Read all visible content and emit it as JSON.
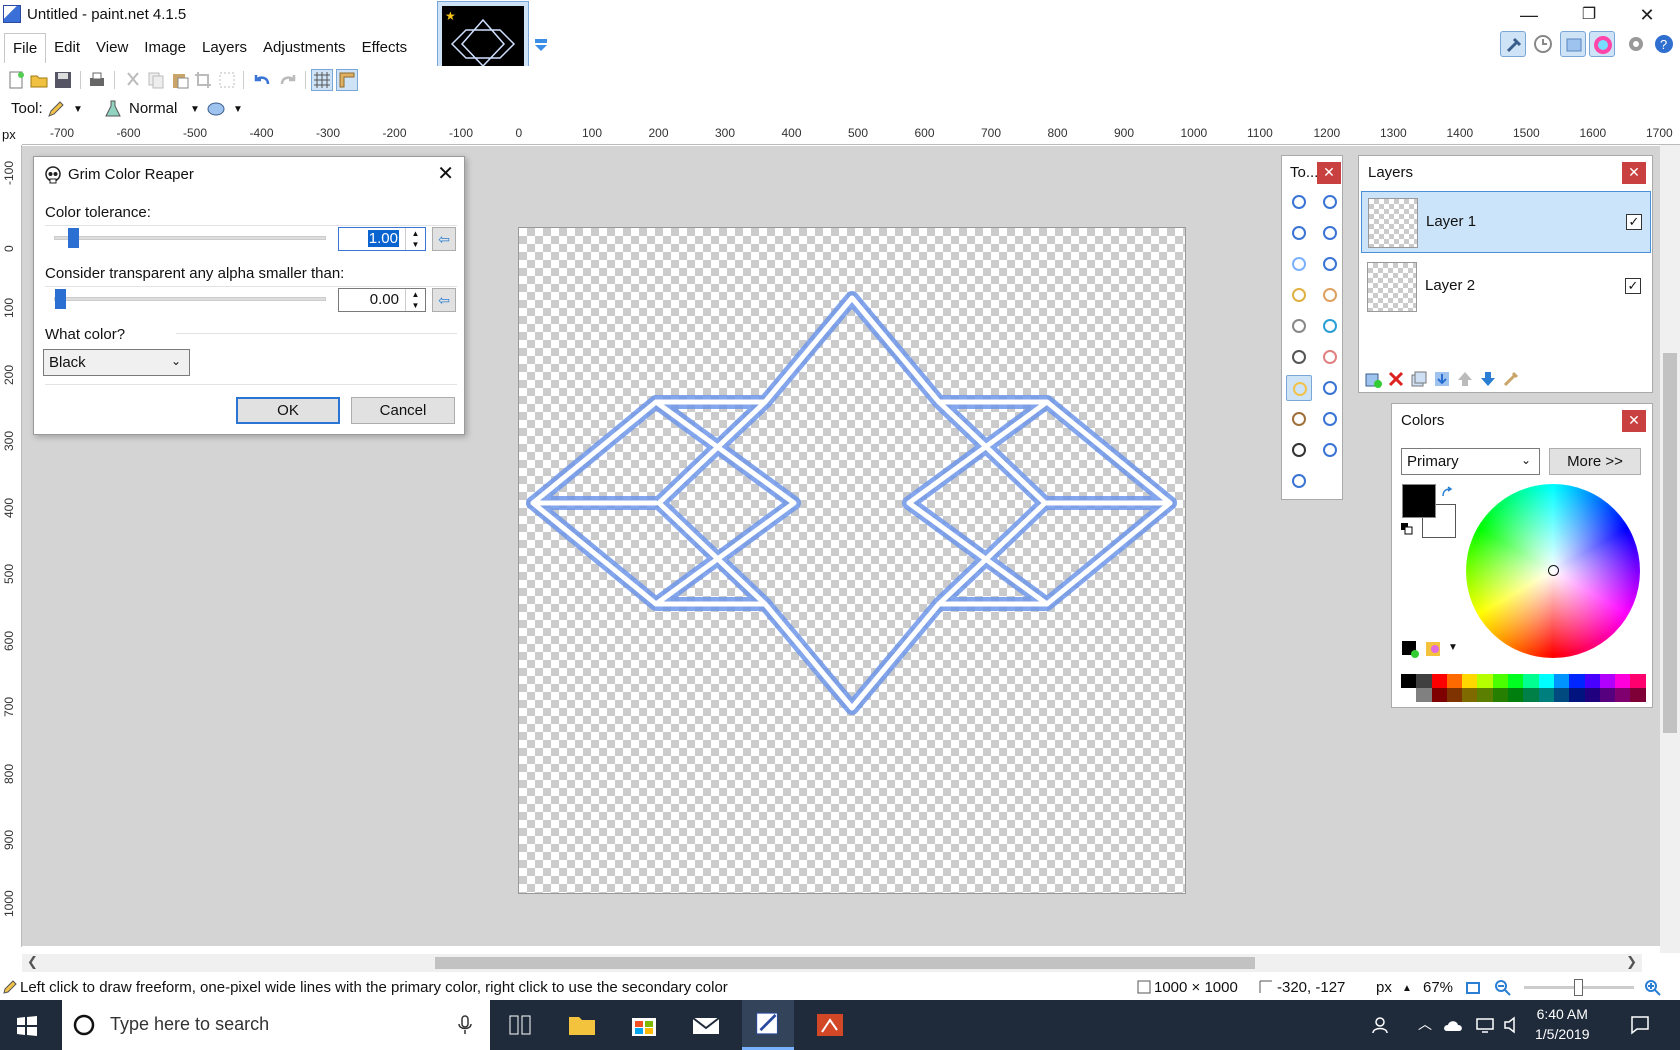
{
  "window": {
    "title": "Untitled - paint.net 4.1.5",
    "minimize": "—",
    "maximize": "❐",
    "close": "✕"
  },
  "menu": [
    "File",
    "Edit",
    "View",
    "Image",
    "Layers",
    "Adjustments",
    "Effects"
  ],
  "toolbar2": {
    "tool_label": "Tool:",
    "blend_mode": "Normal"
  },
  "ruler": {
    "unit": "px",
    "h_labels": [
      "-700",
      "-600",
      "-500",
      "-400",
      "-300",
      "-200",
      "-100",
      "0",
      "100",
      "200",
      "300",
      "400",
      "500",
      "600",
      "700",
      "800",
      "900",
      "1000",
      "1100",
      "1200",
      "1300",
      "1400",
      "1500",
      "1600",
      "1700"
    ],
    "v_labels": [
      "-100",
      "0",
      "100",
      "200",
      "300",
      "400",
      "500",
      "600",
      "700",
      "800",
      "900",
      "1000"
    ]
  },
  "dialog": {
    "title": "Grim Color Reaper",
    "close": "✕",
    "tolerance_label": "Color tolerance:",
    "tolerance_value": "1.00",
    "tolerance_slider": 0.05,
    "alpha_label": "Consider transparent any alpha smaller than:",
    "alpha_value": "0.00",
    "alpha_slider": 0.0,
    "color_label": "What color?",
    "color_value": "Black",
    "ok": "OK",
    "cancel": "Cancel"
  },
  "tools_panel": {
    "title": "To...",
    "close": "✕"
  },
  "layers_panel": {
    "title": "Layers",
    "close": "✕",
    "layers": [
      {
        "name": "Layer 1",
        "visible": "✓"
      },
      {
        "name": "Layer 2",
        "visible": "✓"
      }
    ]
  },
  "colors_panel": {
    "title": "Colors",
    "close": "✕",
    "mode": "Primary",
    "more_button": "More >>",
    "primary_color": "#000000",
    "secondary_color": "#ffffff"
  },
  "status": {
    "hint": "Left click to draw freeform, one-pixel wide lines with the primary color, right click to use the secondary color",
    "image_size": "1000 × 1000",
    "cursor_pos": "-320, -127",
    "unit": "px",
    "zoom": "67%"
  },
  "taskbar": {
    "search_placeholder": "Type here to search",
    "time": "6:40 AM",
    "date": "1/5/2019"
  }
}
